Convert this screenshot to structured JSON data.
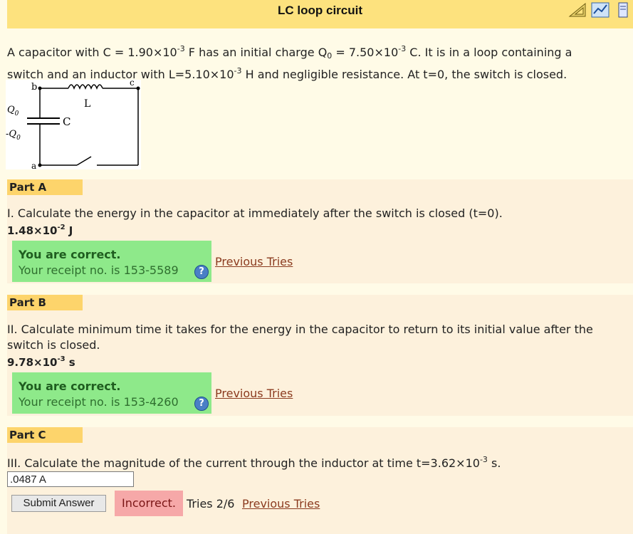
{
  "header": {
    "title": "LC loop circuit"
  },
  "problem": {
    "line1": {
      "t1": "A capacitor with C = 1.90×10",
      "e1": "-3",
      "t2": " F has an initial charge Q",
      "s1": "0",
      "t3": " = 7.50×10",
      "e2": "-3",
      "t4": " C. It is in a loop containing a"
    },
    "line2": {
      "t1": "switch and an inductor with L=5.10×10",
      "e1": "-3",
      "t2": " H and negligible resistance. At t=0, the switch is closed."
    }
  },
  "circuit": {
    "label_b": "b",
    "label_c": "c",
    "label_L": "L",
    "label_C": "C",
    "label_Q0": "Q",
    "label_negQ0": "-Q",
    "sub0": "0",
    "label_a": "a"
  },
  "partA": {
    "label": "Part A",
    "question": "I. Calculate the energy in the capacitor at immediately after the switch is closed (t=0).",
    "answer_mant": "1.48×10",
    "answer_exp": "-2",
    "answer_unit": " J",
    "status": "You are correct.",
    "receipt": "Your receipt no. is 153-5589",
    "prev": "Previous Tries"
  },
  "partB": {
    "label": "Part B",
    "question_l1": "II. Calculate minimum time it takes for the energy in the capacitor to return to its initial value after the",
    "question_l2": "switch is closed.",
    "answer_mant": "9.78×10",
    "answer_exp": "-3",
    "answer_unit": " s",
    "status": "You are correct.",
    "receipt": "Your receipt no. is 153-4260",
    "prev": "Previous Tries"
  },
  "partC": {
    "label": "Part C",
    "question_t1": "III. Calculate the magnitude of the current through the inductor at time t=3.62×10",
    "question_exp": "-3",
    "question_t2": " s.",
    "input_value": ".0487 A",
    "submit": "Submit Answer",
    "status": "Incorrect.",
    "tries": "Tries 2/6",
    "prev": "Previous Tries"
  },
  "icons": {
    "help": "?"
  },
  "colors": {
    "header": "#fde27e",
    "part_bg": "#fdf1dc",
    "part_label": "#fdd46b",
    "correct": "#8ee98a",
    "incorrect": "#f6a8a8",
    "link": "#8b3b1f"
  }
}
